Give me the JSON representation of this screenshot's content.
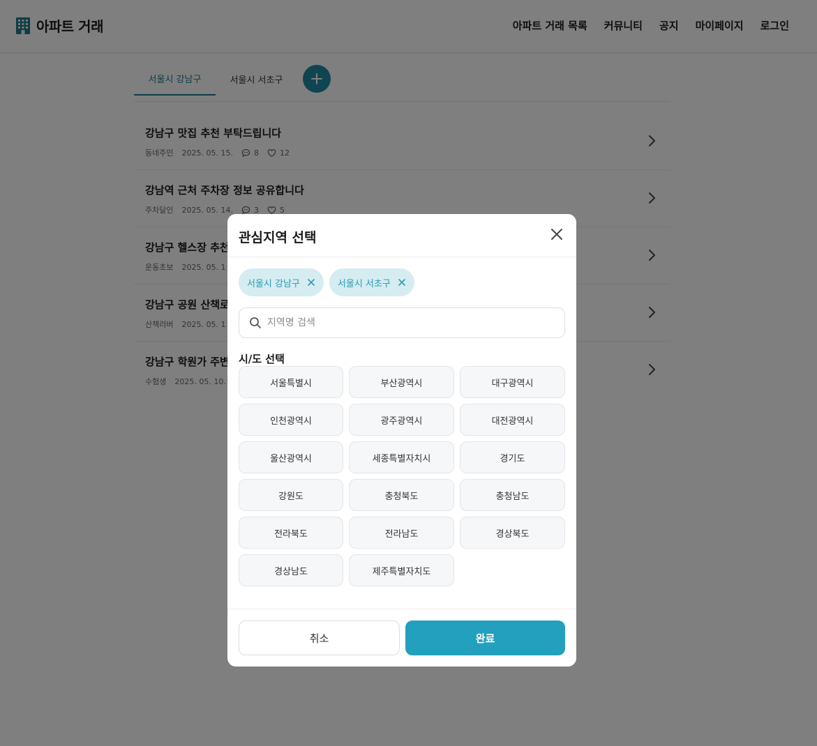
{
  "header": {
    "logo_text": "아파트 거래",
    "nav": [
      "아파트 거래 목록",
      "커뮤니티",
      "공지",
      "마이페이지",
      "로그인"
    ]
  },
  "tabs": {
    "items": [
      "서울시 강남구",
      "서울시 서초구"
    ],
    "active_index": 0,
    "add_icon": "plus-icon"
  },
  "posts": [
    {
      "title": "강남구 맛집 추천 부탁드립니다",
      "author": "동네주민",
      "date": "2025. 05. 15.",
      "comments": "8",
      "likes": "12"
    },
    {
      "title": "강남역 근처 주차장 정보 공유합니다",
      "author": "주차달인",
      "date": "2025. 05. 14.",
      "comments": "3",
      "likes": "5"
    },
    {
      "title": "강남구 헬스장 추천",
      "author": "운동초보",
      "date": "2025. 05. 1",
      "comments": "",
      "likes": ""
    },
    {
      "title": "강남구 공원 산책로",
      "author": "산책러버",
      "date": "2025. 05. 1",
      "comments": "",
      "likes": ""
    },
    {
      "title": "강남구 학원가 주변",
      "author": "수험생",
      "date": "2025. 05. 10.",
      "comments": "",
      "likes": ""
    }
  ],
  "modal": {
    "title": "관심지역 선택",
    "selected_chips": [
      "서울시 강남구",
      "서울시 서초구"
    ],
    "search_placeholder": "지역명 검색",
    "section_label": "시/도 선택",
    "regions": [
      "서울특별시",
      "부산광역시",
      "대구광역시",
      "인천광역시",
      "광주광역시",
      "대전광역시",
      "울산광역시",
      "세종특별자치시",
      "경기도",
      "강원도",
      "충청북도",
      "충청남도",
      "전라북도",
      "전라남도",
      "경상북도",
      "경상남도",
      "제주특별자치도"
    ],
    "cancel_label": "취소",
    "done_label": "완료"
  },
  "colors": {
    "accent": "#22a0bd",
    "accent_dark": "#1f7a8c",
    "chip_bg": "#d5ecf1",
    "chip_text": "#2b9bb3"
  }
}
